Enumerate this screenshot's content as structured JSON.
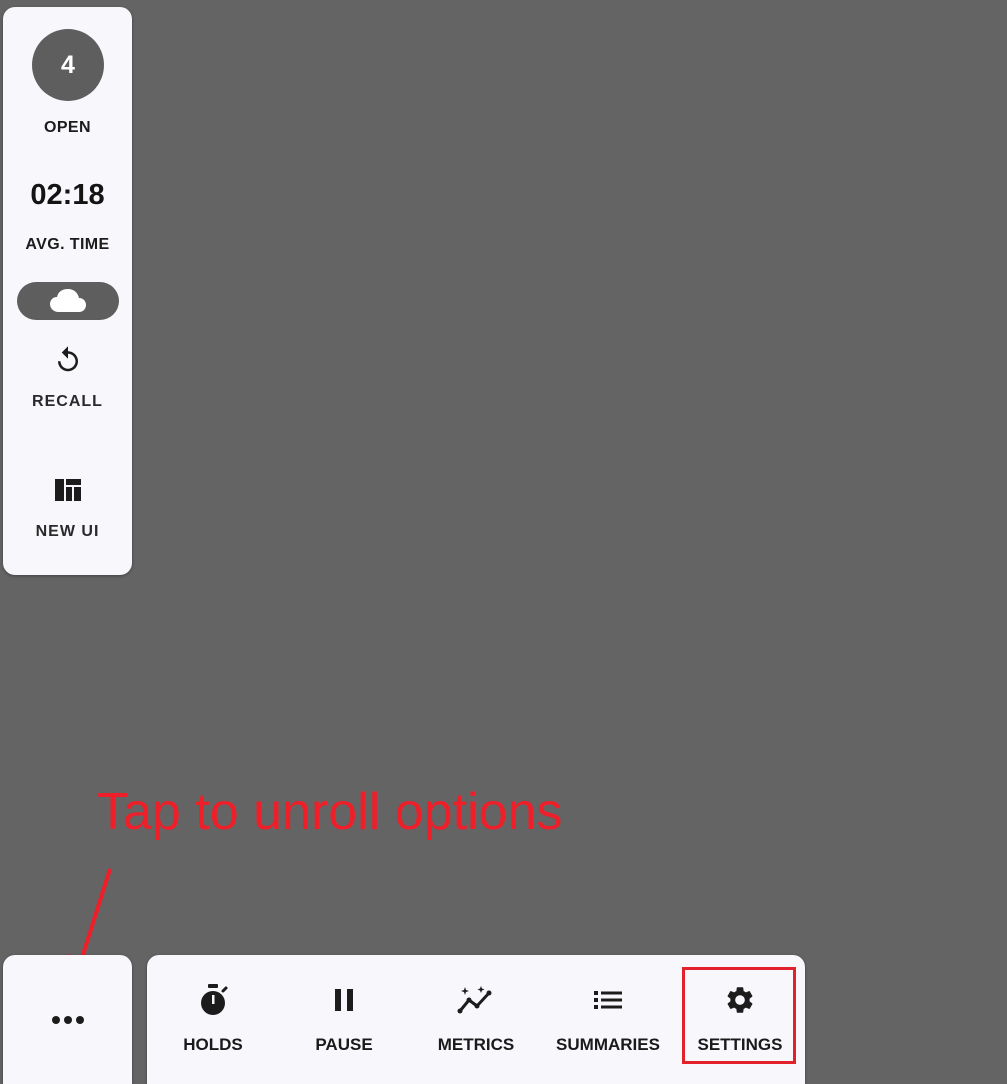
{
  "side_panel": {
    "open_count": "4",
    "open_label": "OPEN",
    "avg_time": "02:18",
    "avg_time_label": "AVG. TIME",
    "cloud_icon": "cloud-icon",
    "recall": {
      "label": "RECALL",
      "icon": "recall-icon"
    },
    "new_ui": {
      "label": "NEW UI",
      "icon": "layout-icon"
    }
  },
  "annotation": {
    "text": "Tap to unroll options",
    "color": "#ef1f2a"
  },
  "more_button": {
    "icon": "more-horizontal-icon"
  },
  "toolbar": {
    "holds": {
      "label": "HOLDS",
      "icon": "timer-icon"
    },
    "pause": {
      "label": "PAUSE",
      "icon": "pause-icon"
    },
    "metrics": {
      "label": "METRICS",
      "icon": "metrics-icon"
    },
    "summaries": {
      "label": "SUMMARIES",
      "icon": "list-icon"
    },
    "settings": {
      "label": "SETTINGS",
      "icon": "gear-icon",
      "highlighted": true
    }
  },
  "colors": {
    "background": "#646464",
    "panel": "#f7f7fc",
    "accent_dark": "#5e5e5e",
    "highlight": "#e2212b"
  }
}
